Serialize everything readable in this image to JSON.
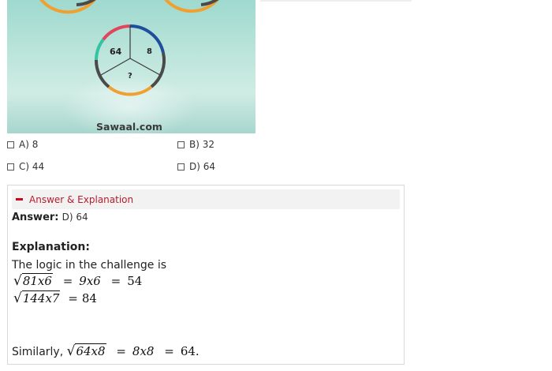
{
  "image": {
    "brand": "Sawaal.com",
    "circle_values": {
      "top_left": "64",
      "top_right": "8",
      "bottom": "?"
    }
  },
  "options": [
    {
      "letter": "A)",
      "value": "8"
    },
    {
      "letter": "B)",
      "value": "32"
    },
    {
      "letter": "C)",
      "value": "44"
    },
    {
      "letter": "D)",
      "value": "64"
    }
  ],
  "answer_panel": {
    "toggle_label": "Answer & Explanation",
    "answer_label": "Answer:",
    "answer_value": "D) 64",
    "explanation_label": "Explanation:",
    "explanation_intro": "The logic in the challenge is",
    "eq1": {
      "radicand": "81x6",
      "mid": "9x6",
      "result": "54"
    },
    "eq2": {
      "radicand": "144x7",
      "result": "84"
    },
    "similar_prefix": "Similarly,",
    "eq3": {
      "radicand": "64x8",
      "mid": "8x8",
      "result": "64."
    }
  },
  "colors": {
    "accent_red": "#d0021b",
    "ring_red": "#e2445c",
    "ring_blue": "#1f4e9c",
    "ring_dark": "#4a4a4a",
    "ring_orange": "#f0a030",
    "ring_teal": "#34c3a3"
  }
}
